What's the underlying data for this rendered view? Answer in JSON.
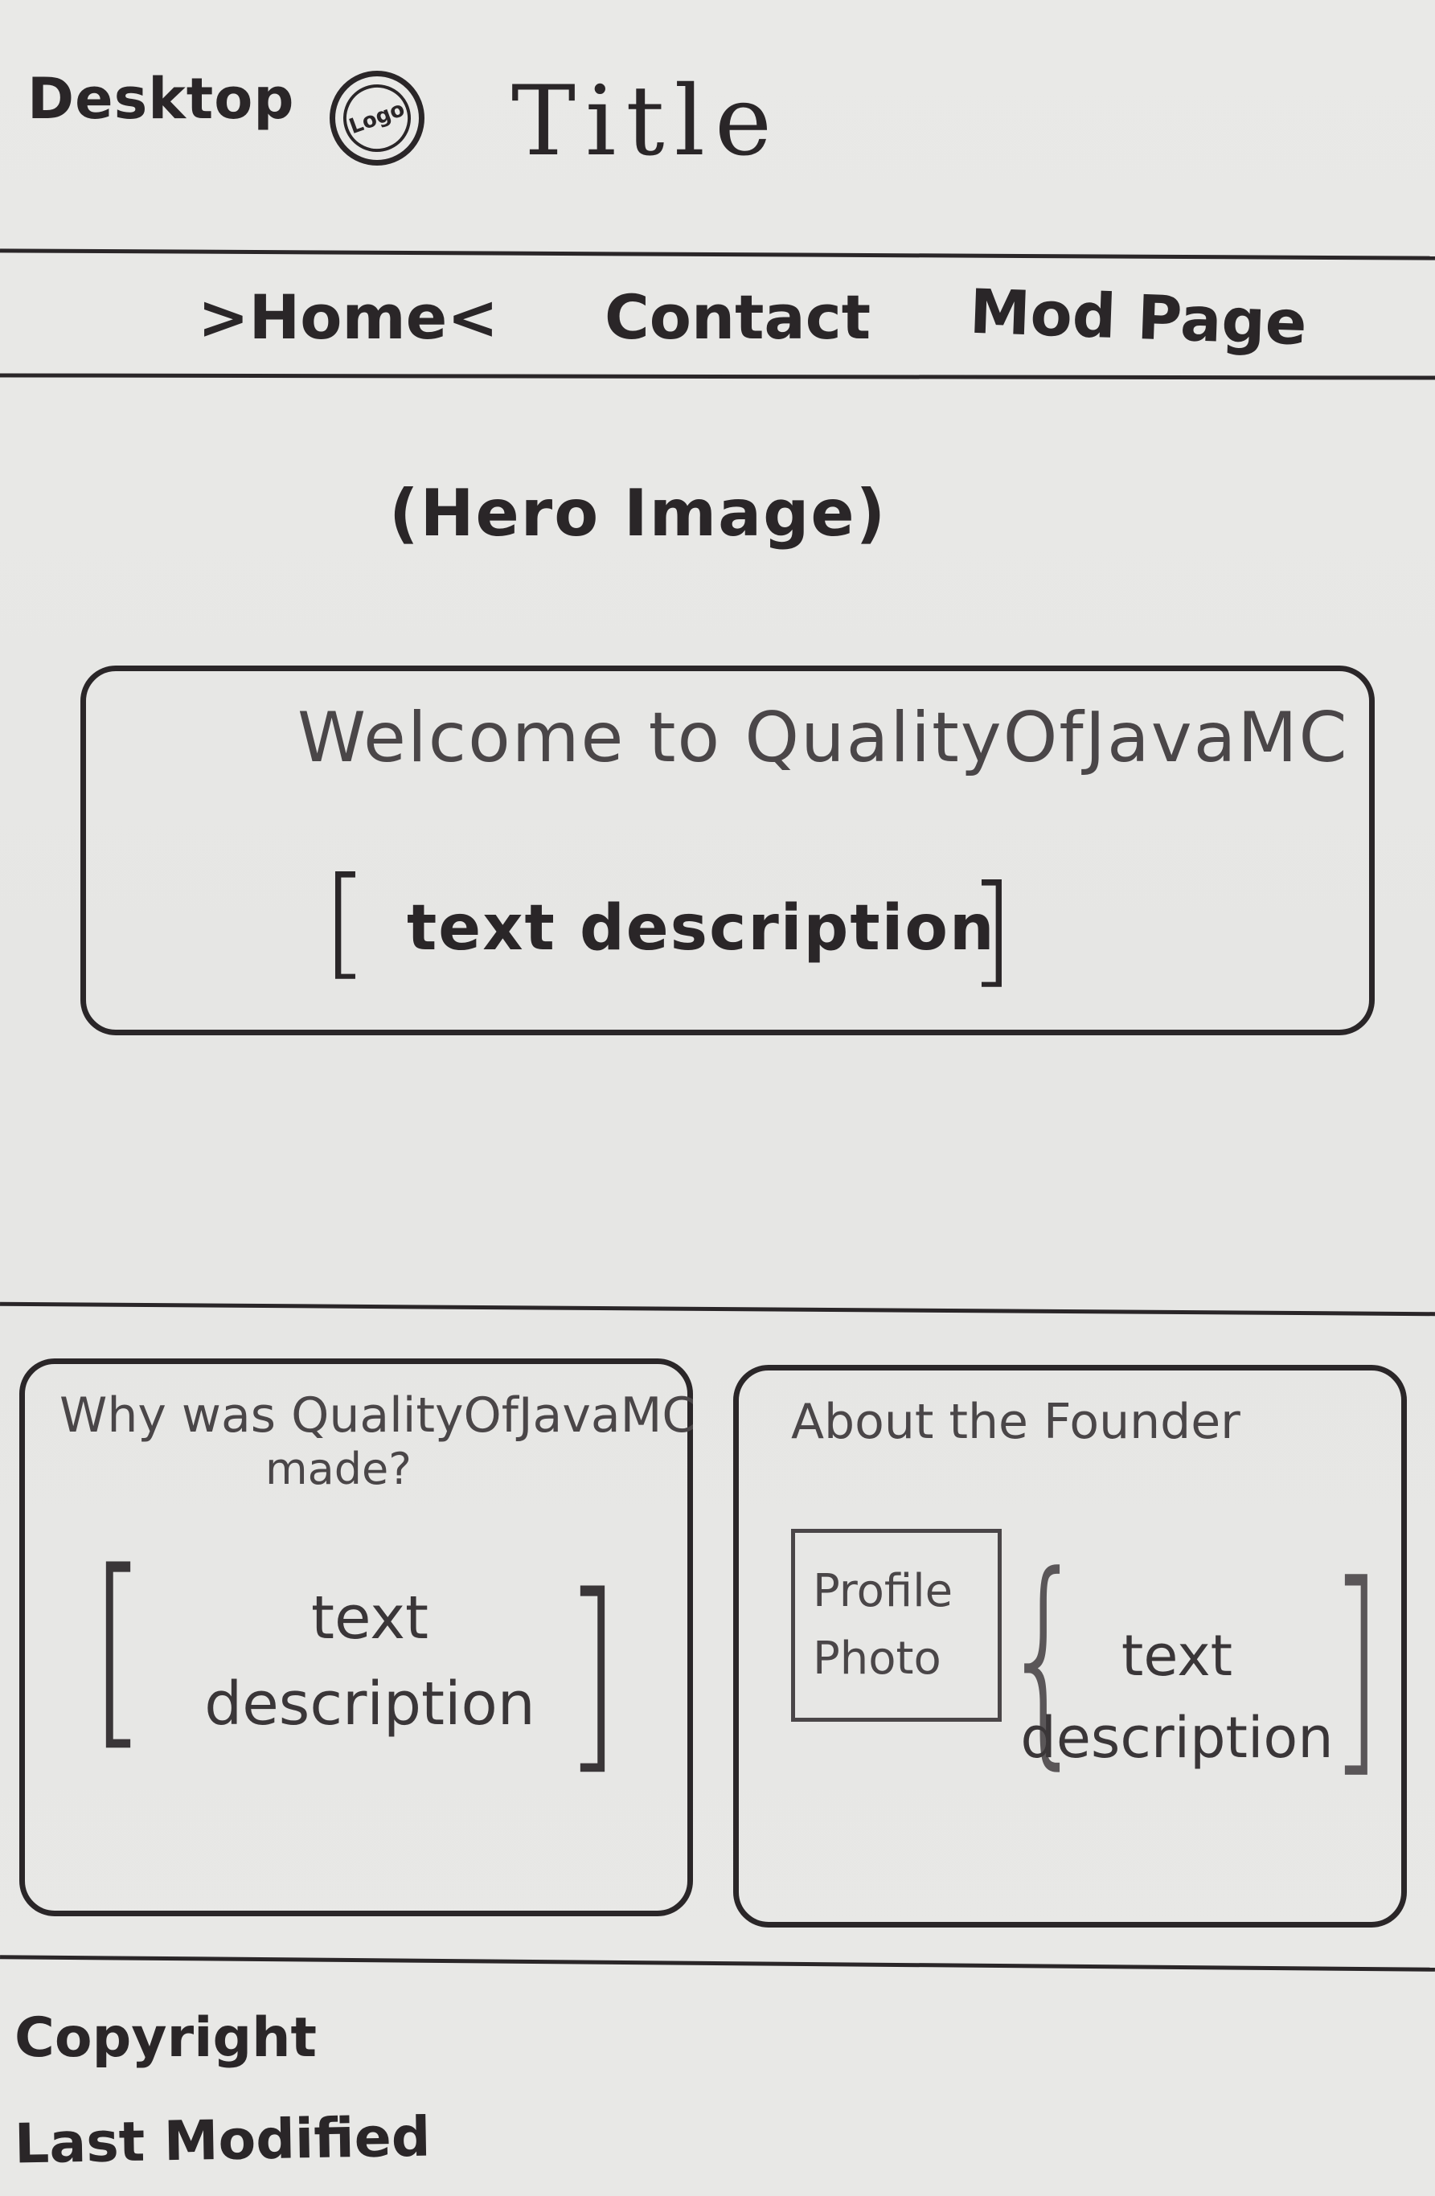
{
  "header": {
    "device_label": "Desktop",
    "logo_text": "Logo",
    "title": "Title"
  },
  "nav": {
    "items": [
      {
        "label": ">Home<"
      },
      {
        "label": "Contact"
      },
      {
        "label": "Mod Page"
      }
    ]
  },
  "hero": {
    "placeholder": "(Hero Image)"
  },
  "welcome": {
    "title": "Welcome to QualityOfJavaMC",
    "desc": "text description"
  },
  "card_why": {
    "title_line1": "Why was QualityOfJavaMC",
    "title_line2": "made?",
    "desc_line1": "text",
    "desc_line2": "description"
  },
  "card_founder": {
    "title": "About the Founder",
    "photo_line1": "Profile",
    "photo_line2": "Photo",
    "desc_line1": "text",
    "desc_line2": "description"
  },
  "footer": {
    "copyright": "Copyright",
    "last_modified": "Last Modified"
  },
  "colors": {
    "ink": "#2a2628",
    "paper": "#e8e8e6"
  }
}
